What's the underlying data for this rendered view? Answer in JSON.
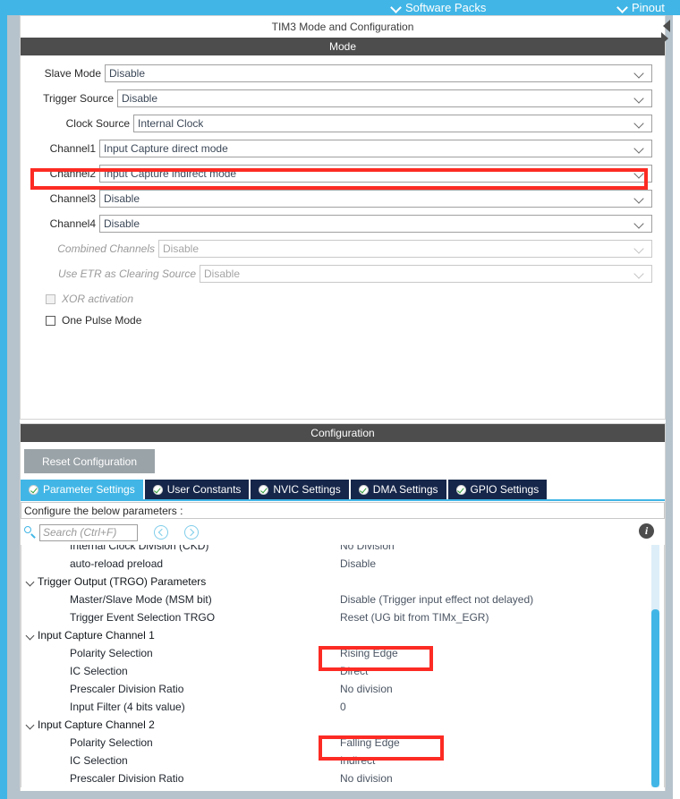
{
  "topbar": {
    "items": [
      {
        "label": "Software Packs",
        "icon": "chevron-down-icon"
      },
      {
        "label": "Pinout",
        "icon": "chevron-down-icon"
      }
    ]
  },
  "mode_panel": {
    "title": "TIM3 Mode and Configuration",
    "section_title": "Mode",
    "rows": [
      {
        "label": "Slave Mode",
        "value": "Disable",
        "disabled": false
      },
      {
        "label": "Trigger Source",
        "value": "Disable",
        "disabled": false
      },
      {
        "label": "Clock Source",
        "value": "Internal Clock",
        "disabled": false
      },
      {
        "label": "Channel1",
        "value": "Input Capture direct mode",
        "disabled": false
      },
      {
        "label": "Channel2",
        "value": "Input Capture indirect mode",
        "disabled": false,
        "highlighted": true
      },
      {
        "label": "Channel3",
        "value": "Disable",
        "disabled": false
      },
      {
        "label": "Channel4",
        "value": "Disable",
        "disabled": false
      },
      {
        "label": "Combined Channels",
        "value": "Disable",
        "disabled": true
      },
      {
        "label": "Use ETR as Clearing Source",
        "value": "Disable",
        "disabled": true
      }
    ],
    "checkboxes": [
      {
        "label": "XOR activation",
        "checked": false,
        "disabled": true
      },
      {
        "label": "One Pulse Mode",
        "checked": false,
        "disabled": false
      }
    ]
  },
  "config_panel": {
    "section_title": "Configuration",
    "reset_button": "Reset Configuration",
    "tabs": [
      {
        "label": "Parameter Settings",
        "active": true,
        "icon": "check-circle-icon"
      },
      {
        "label": "User Constants",
        "active": false,
        "icon": "check-circle-icon"
      },
      {
        "label": "NVIC Settings",
        "active": false,
        "icon": "check-circle-icon"
      },
      {
        "label": "DMA Settings",
        "active": false,
        "icon": "check-circle-icon"
      },
      {
        "label": "GPIO Settings",
        "active": false,
        "icon": "check-circle-icon"
      }
    ],
    "configure_note": "Configure the below parameters :",
    "search": {
      "placeholder": "Search (Ctrl+F)",
      "value": "",
      "icon": "search-icon",
      "prev_icon": "chevron-left-circle-icon",
      "next_icon": "chevron-right-circle-icon"
    },
    "info_icon_label": "i",
    "tree": [
      {
        "type": "child",
        "name": "Internal Clock Division (CKD)",
        "value": "No Division"
      },
      {
        "type": "child",
        "name": "auto-reload preload",
        "value": "Disable"
      },
      {
        "type": "group",
        "name": "Trigger Output (TRGO) Parameters",
        "value": ""
      },
      {
        "type": "child",
        "name": "Master/Slave Mode (MSM bit)",
        "value": "Disable (Trigger input effect not delayed)"
      },
      {
        "type": "child",
        "name": "Trigger Event Selection TRGO",
        "value": "Reset (UG bit from TIMx_EGR)"
      },
      {
        "type": "group",
        "name": "Input Capture Channel 1",
        "value": ""
      },
      {
        "type": "child",
        "name": "Polarity Selection",
        "value": "Rising Edge",
        "highlighted": true
      },
      {
        "type": "child",
        "name": "IC Selection",
        "value": "Direct"
      },
      {
        "type": "child",
        "name": "Prescaler Division Ratio",
        "value": "No division"
      },
      {
        "type": "child",
        "name": "Input Filter (4 bits value)",
        "value": "0"
      },
      {
        "type": "group",
        "name": "Input Capture Channel 2",
        "value": ""
      },
      {
        "type": "child",
        "name": "Polarity Selection",
        "value": "Falling Edge",
        "highlighted": true
      },
      {
        "type": "child",
        "name": "IC Selection",
        "value": "Indirect"
      },
      {
        "type": "child",
        "name": "Prescaler Division Ratio",
        "value": "No division"
      }
    ]
  },
  "colors": {
    "accent_blue": "#41b6e6",
    "tab_inactive": "#16264a",
    "section_bar": "#4d4d4d",
    "highlight_red": "#fc2b24",
    "reset_button": "#9aa3a8",
    "check_green": "#2e9e34"
  }
}
